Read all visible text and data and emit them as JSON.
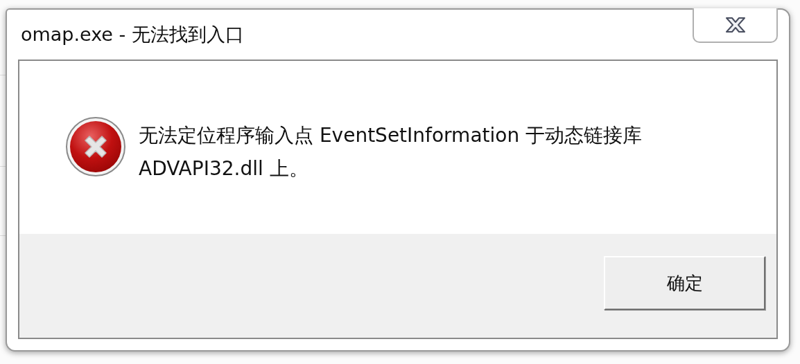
{
  "window": {
    "title": "omap.exe - 无法找到入口"
  },
  "dialog": {
    "kind": "error",
    "message": "无法定位程序输入点 EventSetInformation 于动态链接库 ADVAPI32.dll 上。"
  },
  "buttons": [
    {
      "label": "确定"
    }
  ]
}
